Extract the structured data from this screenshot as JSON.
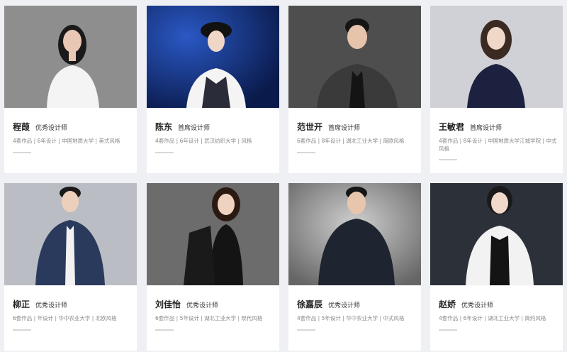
{
  "designers": [
    {
      "name": "程葭",
      "title": "优秀设计师",
      "meta": "4套作品 | 6年设计 | 中国地质大学 | 美式风格",
      "bg": "#8c8c8c",
      "suit": "#f4f4f4",
      "hair": "#1a1a1a"
    },
    {
      "name": "陈东",
      "title": "首席设计师",
      "meta": "4套作品 | 6年设计 | 武汉纺织大学 | 风格",
      "bg": "#0f2a6a",
      "suit": "#2a2c3a",
      "hair": "#111111"
    },
    {
      "name": "范世开",
      "title": "首席设计师",
      "meta": "6套作品 | 8年设计 | 湖北工业大学 | 简欧风格",
      "bg": "#4a4a4a",
      "suit": "#3a3a3a",
      "hair": "#151515"
    },
    {
      "name": "王敏君",
      "title": "首席设计师",
      "meta": "4套作品 | 8年设计 | 中国地质大学江城学院 | 中式风格",
      "bg": "#cfcfd6",
      "suit": "#1c2140",
      "hair": "#3b2a22"
    },
    {
      "name": "柳正",
      "title": "优秀设计师",
      "meta": "6套作品 | 年设计 | 华中农业大学 | 北欧风格",
      "bg": "#b9bcc2",
      "suit": "#2a3a5c",
      "hair": "#1a1a1a"
    },
    {
      "name": "刘佳怡",
      "title": "优秀设计师",
      "meta": "6套作品 | 5年设计 | 湖北工业大学 | 现代风格",
      "bg": "#6a6a6a",
      "suit": "#1a1a1a",
      "hair": "#2a1a12"
    },
    {
      "name": "徐嘉辰",
      "title": "优秀设计师",
      "meta": "4套作品 | 5年设计 | 华中农业大学 | 中式风格",
      "bg": "#777777",
      "suit": "#1e2430",
      "hair": "#151515"
    },
    {
      "name": "赵娇",
      "title": "优秀设计师",
      "meta": "4套作品 | 6年设计 | 湖北工业大学 | 简约风格",
      "bg": "#2c3038",
      "suit": "#f2f2f2",
      "hair": "#1a1a1a"
    }
  ]
}
